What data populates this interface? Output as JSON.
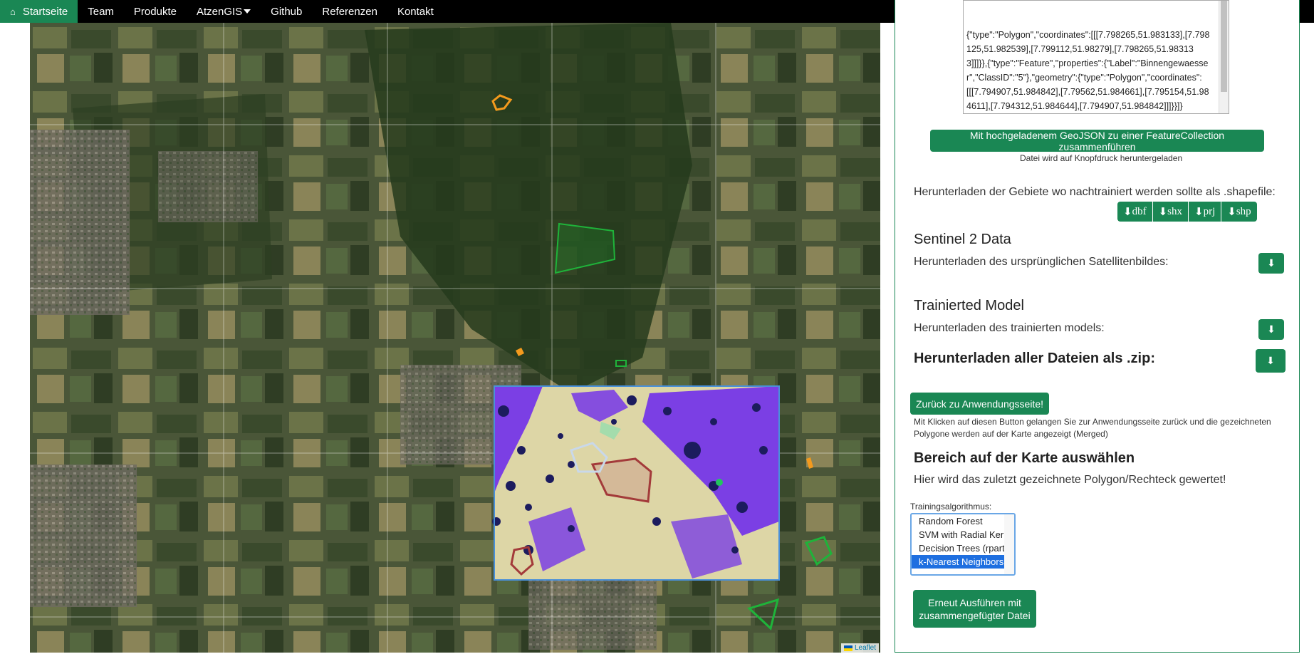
{
  "nav": {
    "items": [
      {
        "label": "Startseite",
        "active": true,
        "icon": "home-icon"
      },
      {
        "label": "Team"
      },
      {
        "label": "Produkte"
      },
      {
        "label": "AtzenGIS",
        "dropdown": true
      },
      {
        "label": "Github"
      },
      {
        "label": "Referenzen"
      },
      {
        "label": "Kontakt"
      }
    ]
  },
  "map": {
    "attribution": "Leaflet"
  },
  "panel": {
    "geojson_text": "{\"type\":\"Polygon\",\"coordinates\":[[[7.798265,51.983133],[7.798125,51.982539],[7.799112,51.98279],[7.798265,51.983133]]]}},{\"type\":\"Feature\",\"properties\":{\"Label\":\"Binnengewaesser\",\"ClassID\":\"5\"},\"geometry\":{\"type\":\"Polygon\",\"coordinates\":[[[7.794907,51.984842],[7.79562,51.984661],[7.795154,51.984611],[7.794312,51.984644],[7.794907,51.984842]]]}}]}",
    "merge_button": "Mit hochgeladenem GeoJSON zu einer FeatureCollection zusammenführen",
    "merge_note": "Datei wird auf Knopfdruck heruntergeladen",
    "retrain_label": "Herunterladen der Gebiete wo nachtrainiert werden sollte als .shapefile:",
    "shapefile_buttons": [
      "dbf",
      "shx",
      "prj",
      "shp"
    ],
    "sentinel_title": "Sentinel 2 Data",
    "sentinel_label": "Herunterladen des ursprünglichen Satellitenbildes:",
    "model_title": "Trainierted Model",
    "model_label": "Herunterladen des trainierten models:",
    "zip_title": "Herunterladen aller Dateien als .zip:",
    "back_button": "Zurück zu Anwendungsseite!",
    "back_note_1": "Mit Klicken auf diesen Button gelangen Sie zur Anwendungsseite zurück und die gezeichneten",
    "back_note_2": "Polygone werden auf der Karte angezeigt (Merged)",
    "area_title": "Bereich auf der Karte auswählen",
    "area_text": "Hier wird das zuletzt gezeichnete Polygon/Rechteck gewertet!",
    "algo_label": "Trainingsalgorithmus:",
    "algo_options": [
      "Random Forest",
      "SVM with Radial Kernel",
      "Decision Trees (rpart)",
      "k-Nearest Neighbors"
    ],
    "algo_selected": "k-Nearest Neighbors",
    "run_button_1": "Erneut Ausführen mit",
    "run_button_2": "zusammengefügter Datei"
  },
  "colors": {
    "accent": "#1a8754",
    "navbar": "#000000",
    "class_water": "#1c1c5e",
    "class_urban": "#7b3fe4",
    "class_field": "#ddd6a6"
  }
}
